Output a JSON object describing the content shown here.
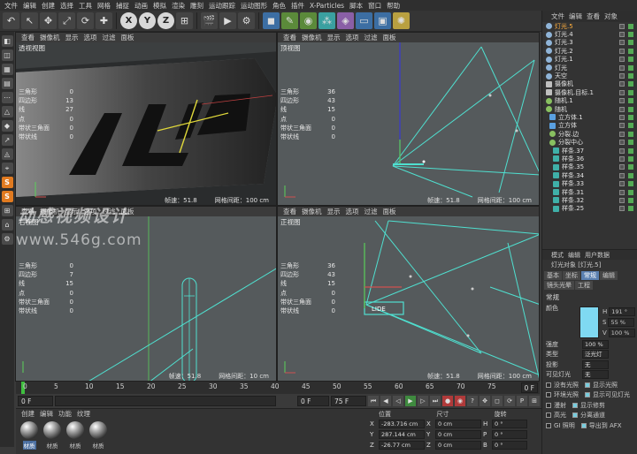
{
  "menu": [
    "文件",
    "编辑",
    "创建",
    "选择",
    "工具",
    "网格",
    "捕捉",
    "动画",
    "模拟",
    "渲染",
    "雕刻",
    "运动跟踪",
    "运动图形",
    "角色",
    "插件",
    "X-Particles",
    "脚本",
    "窗口",
    "帮助"
  ],
  "toolbar": {
    "x": "X",
    "y": "Y",
    "z": "Z"
  },
  "viewports": [
    {
      "menu": [
        "查看",
        "摄像机",
        "显示",
        "选项",
        "过滤",
        "面板"
      ],
      "title": "透视视图",
      "stats": [
        [
          "三角形",
          "0"
        ],
        [
          "四边形",
          "13"
        ],
        [
          "线",
          "27"
        ],
        [
          "点",
          "0"
        ],
        [
          "带状三角面",
          "0"
        ],
        [
          "带状线",
          "0"
        ]
      ],
      "fps": "帧速：51.8",
      "grid": "网格间距：100 cm",
      "logo_text": "LIDE"
    },
    {
      "menu": [
        "查看",
        "摄像机",
        "显示",
        "选项",
        "过滤",
        "面板"
      ],
      "title": "顶视图",
      "stats": [
        [
          "三角形",
          "36"
        ],
        [
          "四边形",
          "43"
        ],
        [
          "线",
          "15"
        ],
        [
          "点",
          "0"
        ],
        [
          "带状三角面",
          "0"
        ],
        [
          "带状线",
          "0"
        ]
      ],
      "fps": "帧速：51.8",
      "grid": "网格间距：100 cm"
    },
    {
      "menu": [
        "查看",
        "摄像机",
        "显示",
        "选项",
        "过滤",
        "面板"
      ],
      "title": "右视图",
      "stats": [
        [
          "三角形",
          "0"
        ],
        [
          "四边形",
          "7"
        ],
        [
          "线",
          "15"
        ],
        [
          "点",
          "0"
        ],
        [
          "带状三角面",
          "0"
        ],
        [
          "带状线",
          "0"
        ]
      ],
      "fps": "帧速：51.8",
      "grid": "网格间距：10 cm"
    },
    {
      "menu": [
        "查看",
        "摄像机",
        "显示",
        "选项",
        "过滤",
        "面板"
      ],
      "title": "正视图",
      "stats": [
        [
          "三角形",
          "36"
        ],
        [
          "四边形",
          "43"
        ],
        [
          "线",
          "15"
        ],
        [
          "点",
          "0"
        ],
        [
          "带状三角面",
          "0"
        ],
        [
          "带状线",
          "0"
        ]
      ],
      "fps": "帧速：51.8",
      "grid": "网格间距：100 cm"
    }
  ],
  "watermark": {
    "line1": "动感视频设计",
    "line2": "www.546g.com"
  },
  "timeline": {
    "ticks": [
      "0",
      "5",
      "10",
      "15",
      "20",
      "25",
      "30",
      "35",
      "40",
      "45",
      "50",
      "55",
      "60",
      "65",
      "70",
      "75"
    ],
    "end": "0 F",
    "current": "0 F",
    "start": "0 F",
    "max": "75 F",
    "max2": "75 F"
  },
  "materials": {
    "menu": [
      "创建",
      "编辑",
      "功能",
      "纹理"
    ],
    "items": [
      "材质",
      "材质",
      "材质",
      "材质"
    ]
  },
  "coords": {
    "headers": [
      "位置",
      "尺寸",
      "旋转"
    ],
    "rows": [
      {
        "a": "X",
        "pos": "-283.716 cm",
        "sa": "X",
        "size": "0 cm",
        "ra": "H",
        "rot": "0 °"
      },
      {
        "a": "Y",
        "pos": "287.144 cm",
        "sa": "Y",
        "size": "0 cm",
        "ra": "P",
        "rot": "0 °"
      },
      {
        "a": "Z",
        "pos": "-26.77 cm",
        "sa": "Z",
        "size": "0 cm",
        "ra": "B",
        "rot": "0 °"
      }
    ]
  },
  "objects": {
    "menu": [
      "文件",
      "编辑",
      "查看",
      "对象"
    ],
    "items": [
      "灯光.5",
      "灯光.4",
      "灯光.3",
      "灯光.2",
      "灯光.1",
      "灯光",
      "天空",
      "摄像机",
      "摄像机.目标.1",
      "随机.1",
      "随机",
      "立方体.1",
      "立方体",
      "分裂.边",
      "分裂中心",
      "样条.37",
      "样条.36",
      "样条.35",
      "样条.34",
      "样条.33",
      "样条.31",
      "样条.32",
      "样条.25"
    ]
  },
  "attributes": {
    "menu": [
      "模式",
      "编辑",
      "用户数据"
    ],
    "title": "灯光对象 [灯光.5]",
    "tabs": [
      "基本",
      "坐标",
      "常规",
      "编辑",
      "镜头光晕",
      "工程"
    ],
    "section": "常规",
    "color_label": "颜色",
    "h": "191 °",
    "s": "55 %",
    "v": "100 %",
    "rows": [
      [
        "强度",
        "100 %"
      ],
      [
        "类型",
        "泛光灯"
      ],
      [
        "投影",
        "无"
      ],
      [
        "可见灯光",
        "无"
      ]
    ],
    "checks": [
      [
        "没有光照",
        "显示光照"
      ],
      [
        "环境光照",
        "显示可见灯光"
      ],
      [
        "漫射",
        "显示修剪"
      ],
      [
        "高光",
        "分离通道"
      ],
      [
        "GI 照明",
        "导出到 AFX"
      ]
    ]
  },
  "colors": {
    "accent": "#ffae3d",
    "light_color": "#7fd9f2",
    "cyan": "#4fe0d0"
  }
}
